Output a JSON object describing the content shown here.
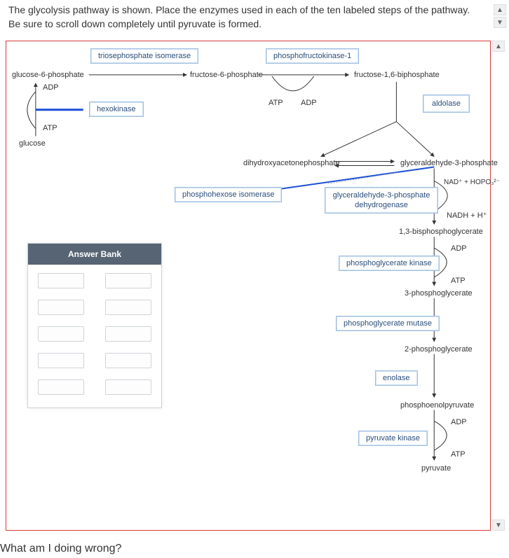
{
  "prompt": "The glycolysis pathway is shown. Place the enzymes used in each of the ten labeled steps of the pathway. Be sure to scroll down completely until pyruvate is formed.",
  "footer_question": "What am I doing wrong?",
  "answer_bank_title": "Answer Bank",
  "metabolites": {
    "glucose6p": "glucose-6-phosphate",
    "fructose6p": "fructose-6-phosphate",
    "fructose16bp": "fructose-1,6-biphosphate",
    "glucose": "glucose",
    "dhap": "dihydroxyacetonephosphate",
    "g3p": "glyceraldehyde-3-phosphate",
    "bpg13": "1,3-bisphosphoglycerate",
    "pg3": "3-phosphoglycerate",
    "pg2": "2-phosphoglycerate",
    "pep": "phosphoenolpyruvate",
    "pyruvate": "pyruvate"
  },
  "cofactors": {
    "adp1": "ADP",
    "atp1": "ATP",
    "atp2": "ATP",
    "adp2": "ADP",
    "nad_hopo": "NAD⁺ + HOPO₃²⁻",
    "nadh_h": "NADH + H⁺",
    "adp3": "ADP",
    "atp3": "ATP",
    "adp4": "ADP",
    "atp4": "ATP"
  },
  "enzymes": {
    "triosephosphate_isomerase": "triosephosphate isomerase",
    "phosphofructokinase1": "phosphofructokinase-1",
    "hexokinase": "hexokinase",
    "aldolase": "aldolase",
    "phosphohexose_isomerase": "phosphohexose isomerase",
    "g3p_dehydrogenase": "glyceraldehyde-3-phosphate dehydrogenase",
    "phosphoglycerate_kinase": "phosphoglycerate kinase",
    "phosphoglycerate_mutase": "phosphoglycerate mutase",
    "enolase": "enolase",
    "pyruvate_kinase": "pyruvate kinase"
  },
  "scroll": {
    "up": "▲",
    "down": "▼"
  }
}
